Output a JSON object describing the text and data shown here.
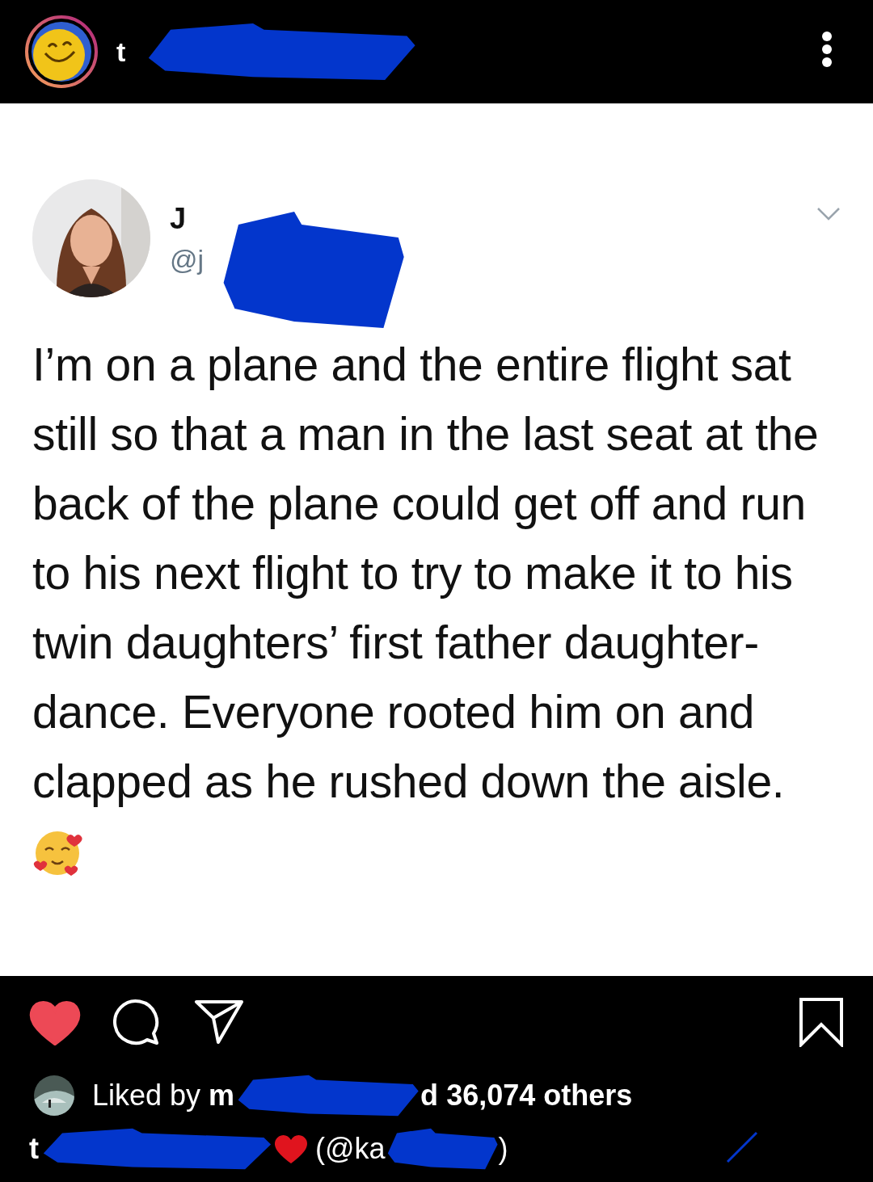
{
  "header": {
    "username_visible": "t"
  },
  "tweet": {
    "name_visible": "J",
    "handle_visible": "@j",
    "text_lines": [
      "I’m on a plane and the entire flight sat",
      "still so that a man in the last seat at the",
      "back of the plane could get off and run",
      "to his next flight to try to make it to his",
      "twin daughters’ first father daughter-",
      "dance. Everyone rooted him on and",
      "clapped as he rushed down the aisle."
    ]
  },
  "actions": {
    "liked": true,
    "saved": false
  },
  "likes": {
    "prefix": "Liked by ",
    "name_start": "m",
    "name_end": "d",
    "count": "36,074 others"
  },
  "caption": {
    "start": "t",
    "mention_start": "(@ka",
    "mention_end": ")"
  }
}
